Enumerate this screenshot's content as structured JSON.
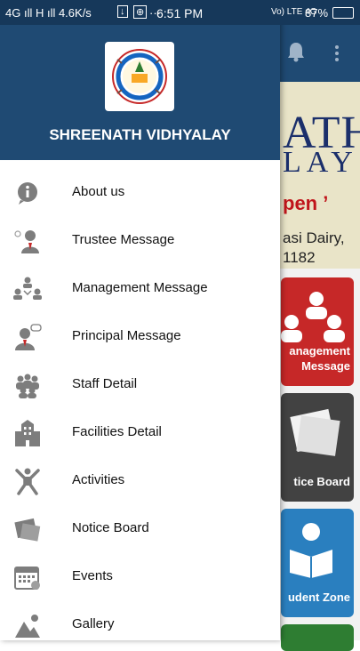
{
  "status_bar": {
    "left": "4G ıll  H ıll  4.6K/s",
    "time": "6:51 PM",
    "right": "Vo) LTE 4G",
    "battery": "87%"
  },
  "drawer": {
    "school_name": "SHREENATH VIDHYALAY",
    "logo_text": "SHREENATH VIDHYALAY",
    "items": [
      {
        "label": "About us",
        "icon": "info-icon"
      },
      {
        "label": "Trustee Message",
        "icon": "trustee-icon"
      },
      {
        "label": "Management Message",
        "icon": "management-icon"
      },
      {
        "label": "Principal Message",
        "icon": "principal-icon"
      },
      {
        "label": "Staff Detail",
        "icon": "staff-icon"
      },
      {
        "label": "Facilities Detail",
        "icon": "building-icon"
      },
      {
        "label": "Activities",
        "icon": "activities-icon"
      },
      {
        "label": "Notice Board",
        "icon": "notice-icon"
      },
      {
        "label": "Events",
        "icon": "calendar-icon"
      },
      {
        "label": "Gallery",
        "icon": "gallery-icon"
      }
    ]
  },
  "background": {
    "banner_line1": "ATH",
    "banner_line2": "LAY",
    "banner_line3": "pen ’",
    "banner_line4": "asi Dairy,",
    "banner_line5": "1182",
    "tiles": [
      {
        "label": "anagement\nMessage"
      },
      {
        "label": "tice Board"
      },
      {
        "label": "udent Zone"
      }
    ]
  },
  "colors": {
    "header": "#1f4a73",
    "status": "#16385a",
    "icon_gray": "#7d7d7d"
  }
}
